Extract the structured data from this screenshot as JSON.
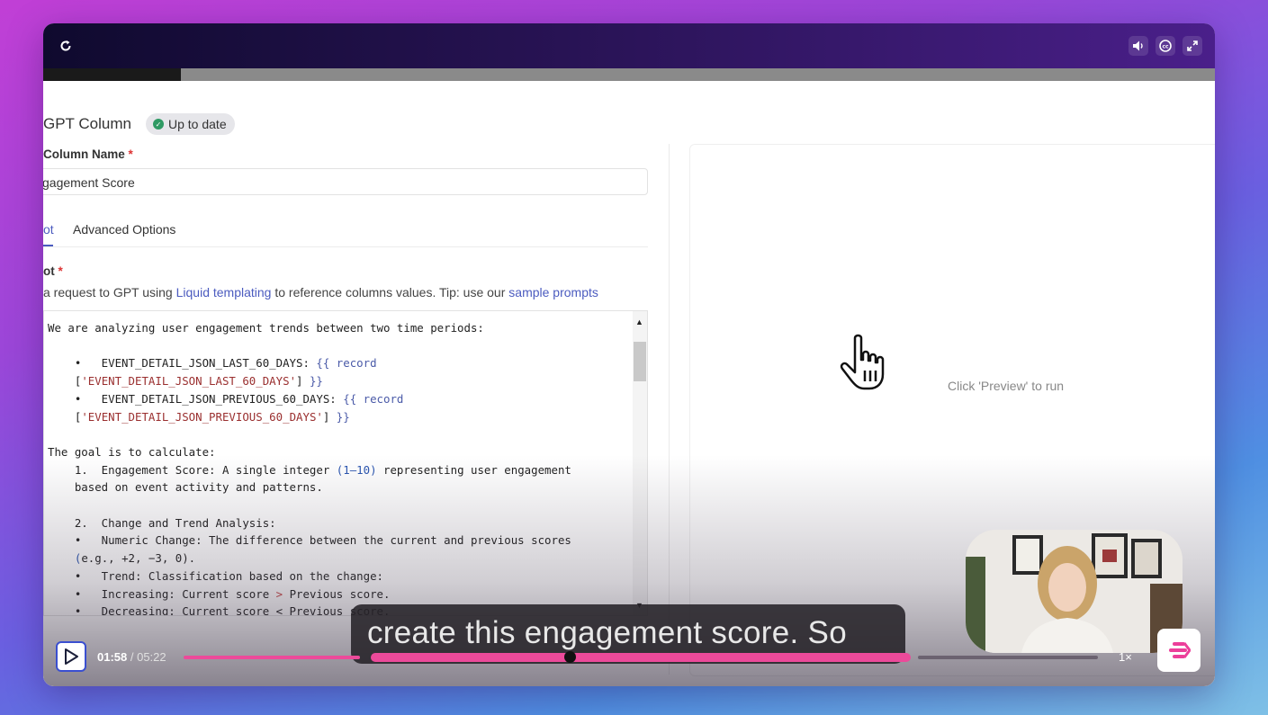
{
  "controls": {
    "replay_icon": "replay-icon",
    "volume_icon": "volume-icon",
    "captions_icon": "captions-icon",
    "fullscreen_icon": "fullscreen-icon"
  },
  "app": {
    "title": "GPT Column",
    "status_badge": "Up to date",
    "column_name_label": "Column Name",
    "required_mark": "*",
    "column_name_value": "gagement Score",
    "tabs": [
      {
        "label": "ot",
        "active": true
      },
      {
        "label": "Advanced Options",
        "active": false
      }
    ],
    "prompt_label": "ot",
    "hint": {
      "prefix": "a request to GPT using ",
      "link1": "Liquid templating",
      "middle": " to reference columns values. Tip: use our ",
      "link2": "sample prompts"
    },
    "code_lines": [
      "We are analyzing user engagement trends between two time periods:",
      "",
      "    •   EVENT_DETAIL_JSON_LAST_60_DAYS: {{ record",
      "    ['EVENT_DETAIL_JSON_LAST_60_DAYS'] }}",
      "    •   EVENT_DETAIL_JSON_PREVIOUS_60_DAYS: {{ record",
      "    ['EVENT_DETAIL_JSON_PREVIOUS_60_DAYS'] }}",
      "",
      "The goal is to calculate:",
      "    1.  Engagement Score: A single integer (1–10) representing user engagement",
      "    based on event activity and patterns.",
      "",
      "    2.  Change and Trend Analysis:",
      "    •   Numeric Change: The difference between the current and previous scores",
      "    (e.g., +2, −3, 0).",
      "    •   Trend: Classification based on the change:",
      "    •   Increasing: Current score > Previous score.",
      "    •   Decreasing: Current score < Previous score."
    ],
    "preview_text": "Click 'Preview' to run"
  },
  "player": {
    "caption": "create this engagement score. So",
    "current_time": "01:58",
    "separator": " / ",
    "duration": "05:22",
    "speed": "1×",
    "progress_fraction": 0.366,
    "accent": "#ec4a9a"
  }
}
